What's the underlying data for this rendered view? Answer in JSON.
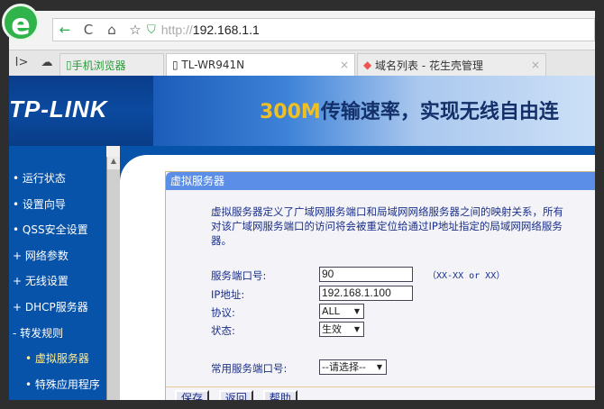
{
  "browser": {
    "back": "←",
    "reload": "C",
    "home": "⌂",
    "star": "☆",
    "url_proto": "http://",
    "url_host": "192.168.1.1",
    "tabs": [
      {
        "label": "手机浏览器"
      },
      {
        "label": "TL-WR941N"
      },
      {
        "label": "域名列表 - 花生壳管理"
      }
    ],
    "close": "×"
  },
  "banner": {
    "logo": "TP-LINK",
    "slogan_num": "300M",
    "slogan": "传输速率，实现无线自由连"
  },
  "sidebar": {
    "items": [
      {
        "label": "• 运行状态"
      },
      {
        "label": "• 设置向导"
      },
      {
        "label": "• QSS安全设置"
      },
      {
        "label": "+ 网络参数"
      },
      {
        "label": "+ 无线设置"
      },
      {
        "label": "+ DHCP服务器"
      },
      {
        "label": "- 转发规则"
      },
      {
        "label": "• 虚拟服务器"
      },
      {
        "label": "• 特殊应用程序"
      }
    ]
  },
  "panel": {
    "title": "虚拟服务器",
    "description": "虚拟服务器定义了广域网服务端口和局域网网络服务器之间的映射关系，所有对该广域网服务端口的访问将会被重定位给通过IP地址指定的局域网网络服务器。",
    "fields": {
      "port_label": "服务端口号:",
      "port_value": "90",
      "port_hint": "（XX-XX or XX）",
      "ip_label": "IP地址:",
      "ip_value": "192.168.1.100",
      "protocol_label": "协议:",
      "protocol_value": "ALL",
      "status_label": "状态:",
      "status_value": "生效",
      "common_label": "常用服务端口号:",
      "common_value": "--请选择--"
    },
    "buttons": {
      "save": "保存",
      "back": "返回",
      "help": "帮助"
    }
  }
}
